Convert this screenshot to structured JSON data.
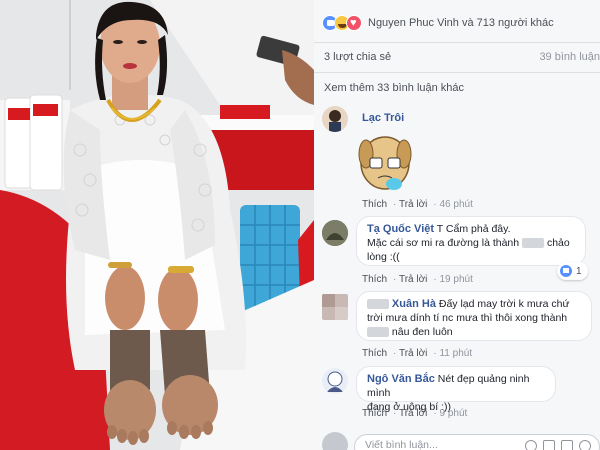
{
  "photo": {
    "icon": "bride-photo"
  },
  "post": {
    "reactions_text": "Nguyen Phuc Vinh và 713 người khác",
    "shares": "3 lượt chia sẻ",
    "comments_count": "39 bình luận",
    "view_more": "Xem thêm 33 bình luận khác"
  },
  "comments": [
    {
      "name": "Lạc Trôi",
      "text": "",
      "actions": {
        "like": "Thích",
        "reply": "Trả lời",
        "time": "46 phút"
      }
    },
    {
      "name": "Tạ Quốc Việt",
      "text_a": "T Cẩm phả đây.",
      "text_b": "Mặc cái sơ mi ra đường là thành",
      "text_c": "chảo",
      "text_d": "lòng :((",
      "actions": {
        "like": "Thích",
        "reply": "Trả lời",
        "time": "19 phút"
      },
      "likes": "1"
    },
    {
      "name": "Xuân Hà",
      "text_a": "Đấy lạd may trời k mưa chứ",
      "text_b": "trời mưa dính tí nc mưa thì thôi xong thành",
      "text_c": "nâu đen luôn",
      "actions": {
        "like": "Thích",
        "reply": "Trả lời",
        "time": "11 phút"
      }
    },
    {
      "name": "Ngô Văn Bắc",
      "text_a": "Nét đẹp quảng ninh mình",
      "text_b": "đang ở uông bí :))",
      "actions": {
        "like": "Thích",
        "reply": "Trả lời",
        "time": "9 phút"
      }
    }
  ],
  "composer": {
    "placeholder": "Viết bình luận..."
  },
  "colors": {
    "fb_blue": "#365899",
    "like_blue": "#5890ff",
    "dress_white": "#f4f4f4",
    "tablecloth_red": "#d71a20"
  }
}
